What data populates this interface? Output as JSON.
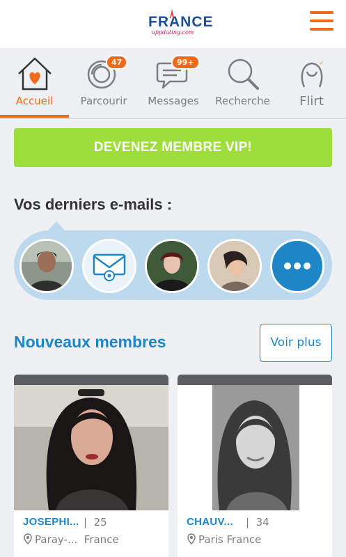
{
  "header": {
    "logo_main": "FRANCE",
    "logo_sub": "uppdating.com"
  },
  "tabs": [
    {
      "label": "Accueil",
      "icon": "house-heart-icon",
      "active": true
    },
    {
      "label": "Parcourir",
      "icon": "browse-rings-icon",
      "badge": "47"
    },
    {
      "label": "Messages",
      "icon": "chat-bubble-icon",
      "badge": "99+"
    },
    {
      "label": "Recherche",
      "icon": "magnifier-icon"
    },
    {
      "label": "Flirt",
      "icon": "flirt-figure-icon"
    }
  ],
  "vip_button": "DEVENEZ MEMBRE VIP!",
  "emails": {
    "title": "Vos derniers e-mails :",
    "items": [
      "avatar-1",
      "envelope-icon",
      "avatar-2",
      "avatar-3",
      "more-icon"
    ]
  },
  "new_members": {
    "title": "Nouveaux membres",
    "see_more": "Voir plus",
    "cards": [
      {
        "name": "JOSEPHI...",
        "age": "25",
        "location": "Paray-...  France"
      },
      {
        "name": "CHAUV...",
        "age": "34",
        "location": "Paris France"
      }
    ]
  },
  "colors": {
    "accent": "#ef6a1a",
    "blue": "#1e86c7",
    "vip_green": "#9ede3c",
    "strip": "#bcd9ee"
  }
}
